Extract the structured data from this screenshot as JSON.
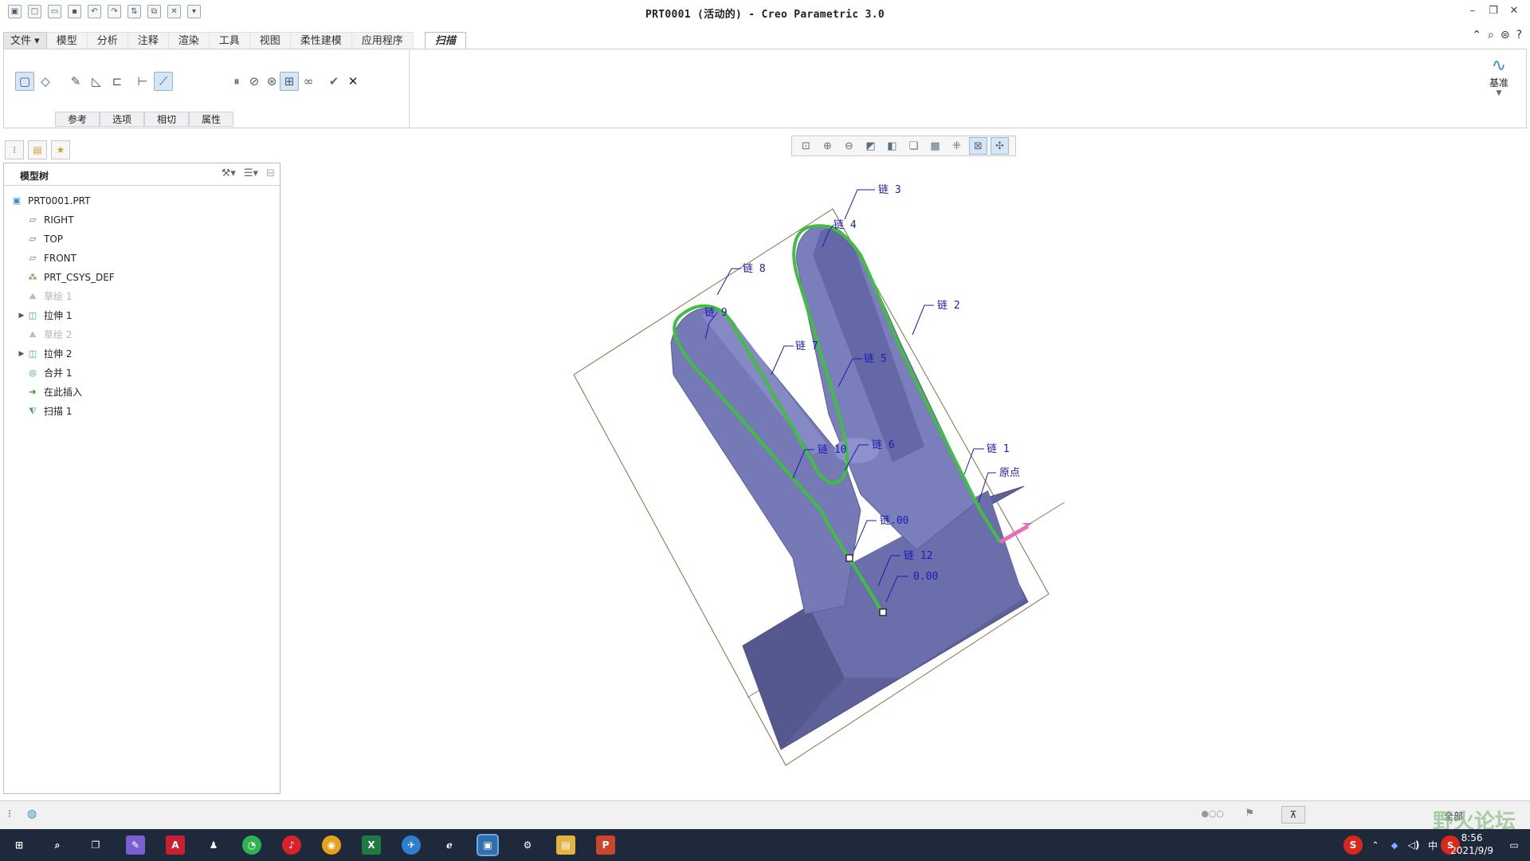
{
  "window": {
    "title": "PRT0001 (活动的) - Creo Parametric 3.0"
  },
  "ribbon": {
    "tabs": [
      "文件",
      "模型",
      "分析",
      "注释",
      "渲染",
      "工具",
      "视图",
      "柔性建模",
      "应用程序"
    ],
    "active_tab": "扫描",
    "subtabs": [
      "参考",
      "选项",
      "相切",
      "属性"
    ],
    "datum_label": "基准"
  },
  "model_tree": {
    "header": "模型树",
    "items": [
      {
        "label": "PRT0001.PRT",
        "icon": "part-icon"
      },
      {
        "label": "RIGHT",
        "icon": "datum-plane-icon"
      },
      {
        "label": "TOP",
        "icon": "datum-plane-icon"
      },
      {
        "label": "FRONT",
        "icon": "datum-plane-icon"
      },
      {
        "label": "PRT_CSYS_DEF",
        "icon": "csys-icon"
      },
      {
        "label": "草绘 1",
        "icon": "sketch-icon"
      },
      {
        "label": "拉伸 1",
        "icon": "extrude-icon"
      },
      {
        "label": "草绘 2",
        "icon": "sketch-icon"
      },
      {
        "label": "拉伸 2",
        "icon": "extrude-icon"
      },
      {
        "label": "合并 1",
        "icon": "merge-icon"
      },
      {
        "label": "在此插入",
        "icon": "insert-here-icon"
      },
      {
        "label": "扫描 1",
        "icon": "sweep-icon"
      }
    ]
  },
  "annotations": {
    "chain3": "链 3",
    "chain4": "链 4",
    "chain8": "链 8",
    "chain9": "链 9",
    "chain2": "链 2",
    "chain7": "链 7",
    "chain5": "链 5",
    "chain10": "链 10",
    "chain6": "链 6",
    "chain1": "链 1",
    "origin": "原点",
    "dim_a": "链.00",
    "chain12": "链 12",
    "dim_b": "0.00"
  },
  "statusbar": {
    "filter": "全部"
  },
  "taskbar": {
    "time": "8:56",
    "date": "2021/9/9",
    "ime": "中"
  },
  "watermark": "野火论坛",
  "colors": {
    "model_fill": "#7378b8",
    "trajectory": "#3fbf3f",
    "annotation": "#1b1bb5",
    "taskbar": "#1e2a3b"
  }
}
